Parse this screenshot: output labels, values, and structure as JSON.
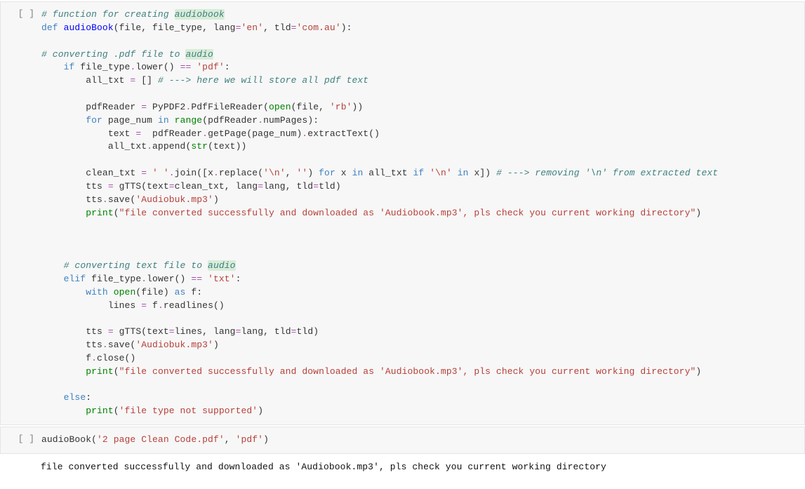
{
  "cells": [
    {
      "prompt": "[ ]",
      "tokens": [
        [
          [
            "c",
            "# function for creating "
          ],
          [
            "c hl",
            "audiobook"
          ]
        ],
        [
          [
            "kb",
            "def"
          ],
          [
            "n",
            " "
          ],
          [
            "nf",
            "audioBook"
          ],
          [
            "n",
            "(file, file_type, lang"
          ],
          [
            "op",
            "="
          ],
          [
            "s",
            "'en'"
          ],
          [
            "n",
            ", tld"
          ],
          [
            "op",
            "="
          ],
          [
            "s",
            "'com.au'"
          ],
          [
            "n",
            "):"
          ]
        ],
        [],
        [
          [
            "c",
            "# converting .pdf file to "
          ],
          [
            "c hl",
            "audio"
          ]
        ],
        [
          [
            "n",
            "    "
          ],
          [
            "kb",
            "if"
          ],
          [
            "n",
            " file_type"
          ],
          [
            "op",
            "."
          ],
          [
            "n",
            "lower() "
          ],
          [
            "op",
            "=="
          ],
          [
            "n",
            " "
          ],
          [
            "s",
            "'pdf'"
          ],
          [
            "n",
            ":"
          ]
        ],
        [
          [
            "n",
            "        all_txt "
          ],
          [
            "op",
            "="
          ],
          [
            "n",
            " [] "
          ],
          [
            "c",
            "# ---> here we will store all pdf text"
          ]
        ],
        [],
        [
          [
            "n",
            "        pdfReader "
          ],
          [
            "op",
            "="
          ],
          [
            "n",
            " PyPDF2"
          ],
          [
            "op",
            "."
          ],
          [
            "n",
            "PdfFileReader("
          ],
          [
            "bn",
            "open"
          ],
          [
            "n",
            "(file, "
          ],
          [
            "s",
            "'rb'"
          ],
          [
            "n",
            "))"
          ]
        ],
        [
          [
            "n",
            "        "
          ],
          [
            "kb",
            "for"
          ],
          [
            "n",
            " page_num "
          ],
          [
            "kb",
            "in"
          ],
          [
            "n",
            " "
          ],
          [
            "bn",
            "range"
          ],
          [
            "n",
            "(pdfReader"
          ],
          [
            "op",
            "."
          ],
          [
            "n",
            "numPages):"
          ]
        ],
        [
          [
            "n",
            "            text "
          ],
          [
            "op",
            "="
          ],
          [
            "n",
            "  pdfReader"
          ],
          [
            "op",
            "."
          ],
          [
            "n",
            "getPage(page_num)"
          ],
          [
            "op",
            "."
          ],
          [
            "n",
            "extractText()"
          ]
        ],
        [
          [
            "n",
            "            all_txt"
          ],
          [
            "op",
            "."
          ],
          [
            "n",
            "append("
          ],
          [
            "bn",
            "str"
          ],
          [
            "n",
            "(text))"
          ]
        ],
        [],
        [
          [
            "n",
            "        clean_txt "
          ],
          [
            "op",
            "="
          ],
          [
            "n",
            " "
          ],
          [
            "s",
            "' '"
          ],
          [
            "op",
            "."
          ],
          [
            "n",
            "join([x"
          ],
          [
            "op",
            "."
          ],
          [
            "n",
            "replace("
          ],
          [
            "s",
            "'\\n'"
          ],
          [
            "n",
            ", "
          ],
          [
            "s",
            "''"
          ],
          [
            "n",
            ") "
          ],
          [
            "kb",
            "for"
          ],
          [
            "n",
            " x "
          ],
          [
            "kb",
            "in"
          ],
          [
            "n",
            " all_txt "
          ],
          [
            "kb",
            "if"
          ],
          [
            "n",
            " "
          ],
          [
            "s",
            "'\\n'"
          ],
          [
            "n",
            " "
          ],
          [
            "kb",
            "in"
          ],
          [
            "n",
            " x]) "
          ],
          [
            "c",
            "# ---> removing '\\n' from extracted text"
          ]
        ],
        [
          [
            "n",
            "        tts "
          ],
          [
            "op",
            "="
          ],
          [
            "n",
            " gTTS(text"
          ],
          [
            "op",
            "="
          ],
          [
            "n",
            "clean_txt, lang"
          ],
          [
            "op",
            "="
          ],
          [
            "n",
            "lang, tld"
          ],
          [
            "op",
            "="
          ],
          [
            "n",
            "tld)"
          ]
        ],
        [
          [
            "n",
            "        tts"
          ],
          [
            "op",
            "."
          ],
          [
            "n",
            "save("
          ],
          [
            "s",
            "'Audiobuk.mp3'"
          ],
          [
            "n",
            ")"
          ]
        ],
        [
          [
            "n",
            "        "
          ],
          [
            "bn",
            "print"
          ],
          [
            "n",
            "("
          ],
          [
            "s",
            "\"file converted successfully and downloaded as 'Audiobook.mp3', pls check you current working directory\""
          ],
          [
            "n",
            ")"
          ]
        ],
        [],
        [],
        [],
        [
          [
            "n",
            "    "
          ],
          [
            "c",
            "# converting text file to "
          ],
          [
            "c hl",
            "audio"
          ]
        ],
        [
          [
            "n",
            "    "
          ],
          [
            "kb",
            "elif"
          ],
          [
            "n",
            " file_type"
          ],
          [
            "op",
            "."
          ],
          [
            "n",
            "lower() "
          ],
          [
            "op",
            "=="
          ],
          [
            "n",
            " "
          ],
          [
            "s",
            "'txt'"
          ],
          [
            "n",
            ":"
          ]
        ],
        [
          [
            "n",
            "        "
          ],
          [
            "kb",
            "with"
          ],
          [
            "n",
            " "
          ],
          [
            "bn",
            "open"
          ],
          [
            "n",
            "(file) "
          ],
          [
            "kb",
            "as"
          ],
          [
            "n",
            " f:"
          ]
        ],
        [
          [
            "n",
            "            lines "
          ],
          [
            "op",
            "="
          ],
          [
            "n",
            " f"
          ],
          [
            "op",
            "."
          ],
          [
            "n",
            "readlines()"
          ]
        ],
        [],
        [
          [
            "n",
            "        tts "
          ],
          [
            "op",
            "="
          ],
          [
            "n",
            " gTTS(text"
          ],
          [
            "op",
            "="
          ],
          [
            "n",
            "lines, lang"
          ],
          [
            "op",
            "="
          ],
          [
            "n",
            "lang, tld"
          ],
          [
            "op",
            "="
          ],
          [
            "n",
            "tld)"
          ]
        ],
        [
          [
            "n",
            "        tts"
          ],
          [
            "op",
            "."
          ],
          [
            "n",
            "save("
          ],
          [
            "s",
            "'Audiobuk.mp3'"
          ],
          [
            "n",
            ")"
          ]
        ],
        [
          [
            "n",
            "        f"
          ],
          [
            "op",
            "."
          ],
          [
            "n",
            "close()"
          ]
        ],
        [
          [
            "n",
            "        "
          ],
          [
            "bn",
            "print"
          ],
          [
            "n",
            "("
          ],
          [
            "s",
            "\"file converted successfully and downloaded as 'Audiobook.mp3', pls check you current working directory\""
          ],
          [
            "n",
            ")"
          ]
        ],
        [],
        [
          [
            "n",
            "    "
          ],
          [
            "kb",
            "else"
          ],
          [
            "n",
            ":"
          ]
        ],
        [
          [
            "n",
            "        "
          ],
          [
            "bn",
            "print"
          ],
          [
            "n",
            "("
          ],
          [
            "s",
            "'file type not supported'"
          ],
          [
            "n",
            ")"
          ]
        ]
      ]
    },
    {
      "prompt": "[ ]",
      "tokens": [
        [
          [
            "n",
            "audioBook("
          ],
          [
            "s",
            "'2 page Clean Code.pdf'"
          ],
          [
            "n",
            ", "
          ],
          [
            "s",
            "'pdf'"
          ],
          [
            "n",
            ")"
          ]
        ]
      ]
    }
  ],
  "output": {
    "text": "file converted successfully and downloaded as 'Audiobook.mp3', pls check you current working directory"
  }
}
